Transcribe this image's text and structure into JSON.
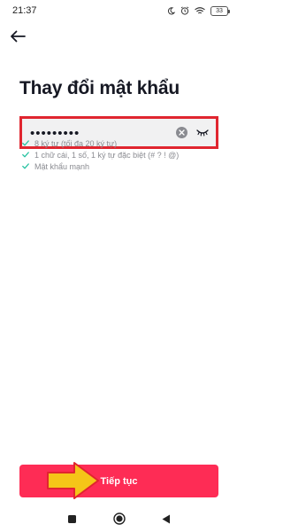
{
  "status_bar": {
    "time": "21:37",
    "battery": "33",
    "icons": [
      "moon-icon",
      "alarm-icon",
      "wifi-icon",
      "battery-icon"
    ]
  },
  "header": {
    "back_icon": "arrow-left-icon"
  },
  "page": {
    "title": "Thay đổi mật khẩu"
  },
  "password_field": {
    "value": "•••••••••",
    "clear_icon": "clear-icon",
    "toggle_icon": "eye-closed-icon"
  },
  "requirements": [
    {
      "text": "8 ký tự (tối đa 20 ký tự)",
      "met": true
    },
    {
      "text": "1 chữ cái, 1 số, 1 ký tự đặc biệt (# ? ! @)",
      "met": true
    },
    {
      "text": "Mật khẩu mạnh",
      "met": true
    }
  ],
  "continue_button": {
    "label": "Tiếp tục"
  },
  "colors": {
    "accent": "#fe2c55",
    "highlight_border": "#e0252f",
    "check": "#25c2a0",
    "annotation_arrow": "#f5c518"
  },
  "nav_bar": {
    "icons": [
      "recent-apps-icon",
      "home-icon",
      "back-triangle-icon"
    ]
  }
}
